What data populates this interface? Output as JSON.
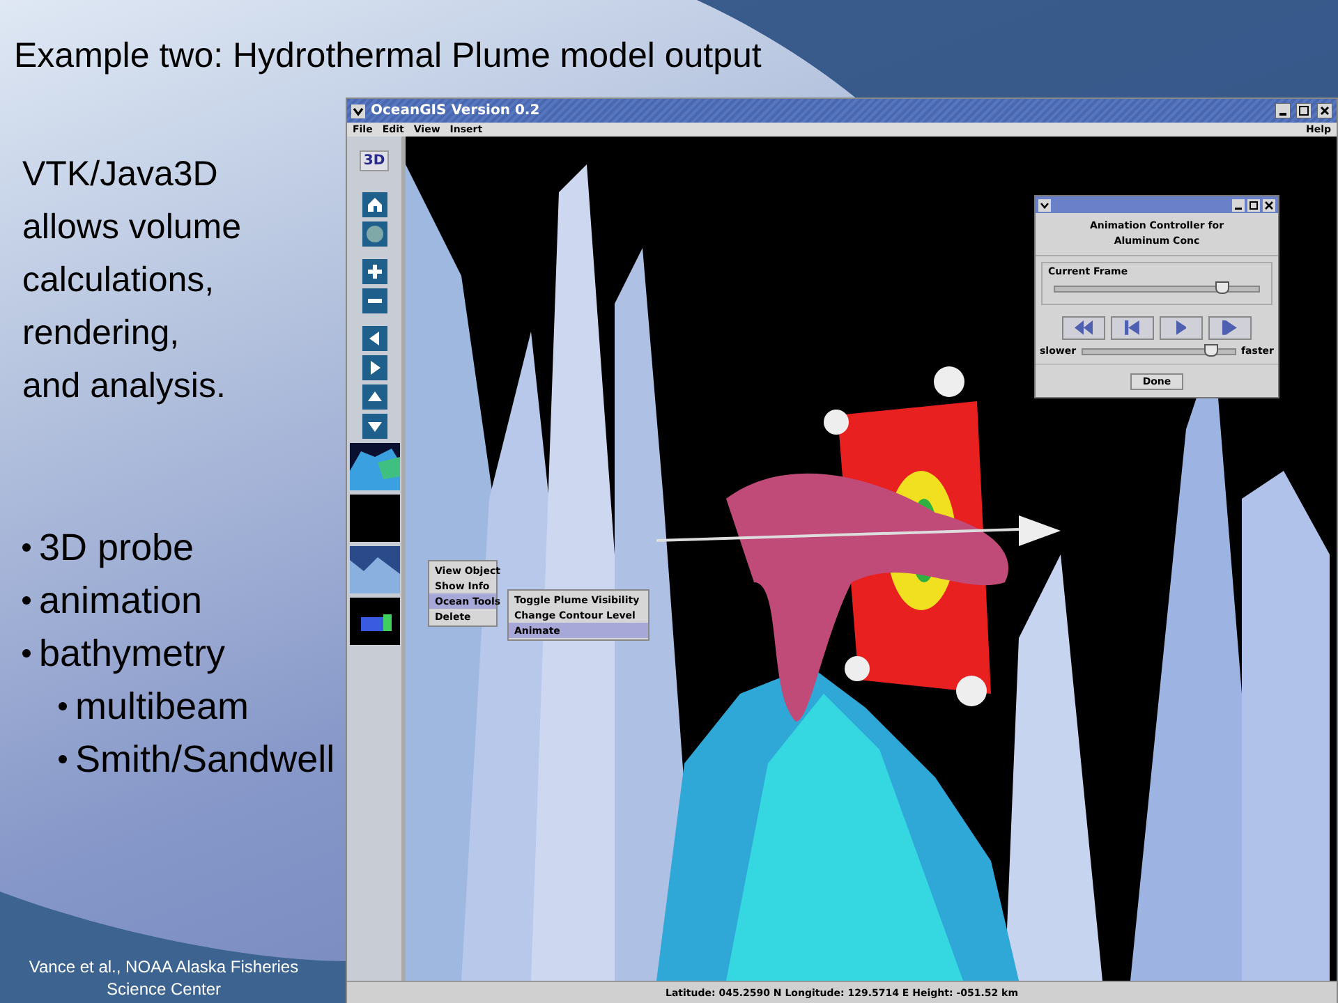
{
  "slide": {
    "title": "Example two: Hydrothermal Plume model output",
    "intro_lines": [
      "VTK/Java3D",
      "allows volume",
      "calculations,",
      "rendering,",
      "and analysis."
    ],
    "bullets": [
      {
        "text": "3D probe"
      },
      {
        "text": "animation"
      },
      {
        "text": "bathymetry",
        "children": [
          {
            "text": "multibeam"
          },
          {
            "text": "Smith/Sandwell"
          }
        ]
      }
    ],
    "credit_lines": [
      "Vance et al., NOAA Alaska Fisheries",
      "Science Center"
    ]
  },
  "app": {
    "title": "OceanGIS Version 0.2",
    "menus": [
      "File",
      "Edit",
      "View",
      "Insert"
    ],
    "help_menu": "Help",
    "toolbar": [
      {
        "kind": "label",
        "text": "3D"
      },
      {
        "kind": "home"
      },
      {
        "kind": "globe"
      },
      {
        "kind": "zoom-in"
      },
      {
        "kind": "zoom-out"
      },
      {
        "kind": "left"
      },
      {
        "kind": "right"
      },
      {
        "kind": "up"
      },
      {
        "kind": "down"
      },
      {
        "kind": "thumb-terrain"
      },
      {
        "kind": "thumb-dark"
      },
      {
        "kind": "thumb-seafloor"
      },
      {
        "kind": "thumb-plume"
      }
    ],
    "context_menu": [
      {
        "label": "View Object",
        "selected": false
      },
      {
        "label": "Show Info",
        "selected": false
      },
      {
        "label": "Ocean Tools",
        "selected": true,
        "children": [
          {
            "label": "Toggle Plume Visibility",
            "selected": false
          },
          {
            "label": "Change Contour Level",
            "selected": false
          },
          {
            "label": "Animate",
            "selected": true
          }
        ]
      },
      {
        "label": "Delete",
        "selected": false
      }
    ],
    "dialog": {
      "heading_lines": [
        "Animation Controller for",
        "Aluminum Conc"
      ],
      "frame_group": "Current Frame",
      "frame_slider": {
        "level": 0.82
      },
      "controls": [
        {
          "kind": "rewind"
        },
        {
          "kind": "step-back"
        },
        {
          "kind": "play"
        },
        {
          "kind": "step-forward"
        }
      ],
      "speed_min": "slower",
      "speed_max": "faster",
      "speed_slider": {
        "level": 0.85
      },
      "done": "Done"
    },
    "status": "Latitude: 045.2590 N Longitude: 129.5714 E Height: -051.52 km"
  }
}
